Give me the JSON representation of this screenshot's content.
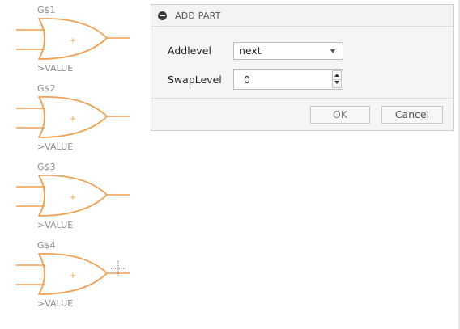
{
  "canvas": {
    "gates": [
      {
        "name": "G$1",
        "value": ">VALUE",
        "origin": "+"
      },
      {
        "name": "G$2",
        "value": ">VALUE",
        "origin": "+"
      },
      {
        "name": "G$3",
        "value": ">VALUE",
        "origin": "+"
      },
      {
        "name": "G$4",
        "value": ">VALUE",
        "origin": "+"
      }
    ],
    "gate_color": "#f0a050",
    "label_color": "#8c8c8c"
  },
  "dialog": {
    "title": "ADD PART",
    "addlevel": {
      "label": "Addlevel",
      "value": "next"
    },
    "swaplevel": {
      "label": "SwapLevel",
      "value": "0"
    },
    "ok_label": "OK",
    "cancel_label": "Cancel"
  }
}
